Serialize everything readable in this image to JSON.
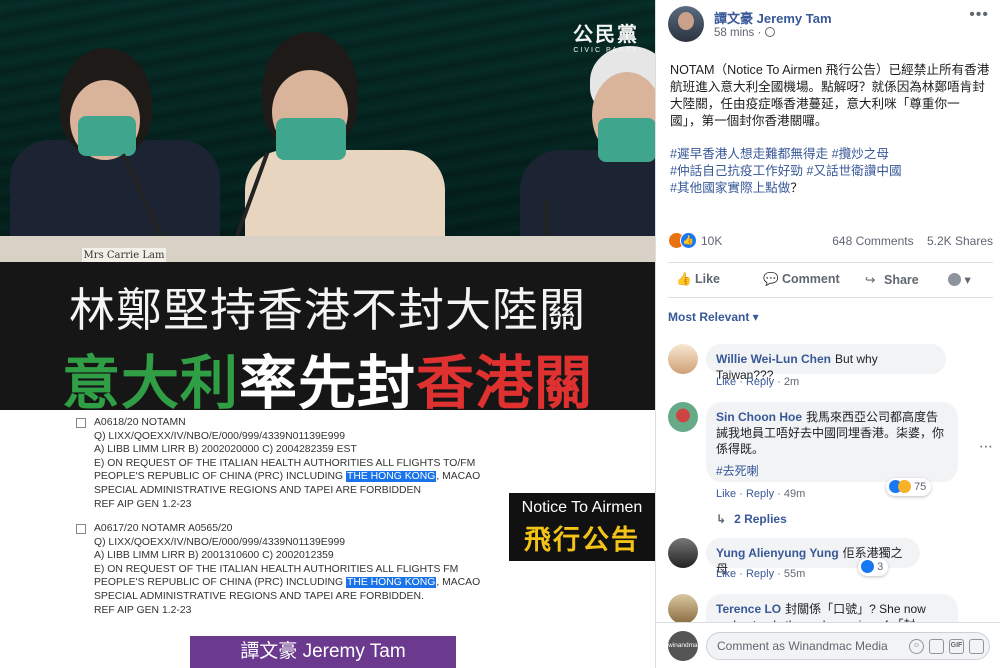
{
  "media": {
    "party_logo_zh": "公民黨",
    "party_logo_en": "CIVIC PARTY",
    "nameplate": "Mrs Carrie Lam",
    "headline_line1": "林鄭堅持香港不封大陸關",
    "headline_line2_parts": [
      {
        "text": "意大利",
        "color": "#2f9e44"
      },
      {
        "text": "率先封",
        "color": "#ffffff"
      },
      {
        "text": "香港關",
        "color": "#e03131"
      }
    ],
    "notams": [
      {
        "lines": [
          "A0618/20 NOTAMN",
          "Q) LIXX/QOEXX/IV/NBO/E/000/999/4339N01139E999",
          "A) LIBB LIMM LIRR B) 2002020000 C) 2004282359 EST",
          "E) ON REQUEST OF THE ITALIAN HEALTH AUTHORITIES ALL FLIGHTS TO/FM"
        ],
        "hl_before": "PEOPLE'S REPUBLIC OF CHINA (PRC) INCLUDING ",
        "hl_text": "THE HONG KONG",
        "hl_after": ", MACAO",
        "tail_lines": [
          "SPECIAL ADMINISTRATIVE REGIONS AND TAPEI ARE FORBIDDEN",
          "REF AIP GEN 1.2-23"
        ]
      },
      {
        "lines": [
          "A0617/20 NOTAMR A0565/20",
          "Q) LIXX/QOEXX/IV/NBO/E/000/999/4339N01139E999",
          "A) LIBB LIMM LIRR B) 2001310600 C) 2002012359",
          "E) ON REQUEST OF THE ITALIAN HEALTH AUTHORITIES ALL FLIGHTS FM"
        ],
        "hl_before": "PEOPLE'S REPUBLIC OF CHINA (PRC) INCLUDING ",
        "hl_text": "THE HONG KONG",
        "hl_after": ", MACAO",
        "tail_lines": [
          "SPECIAL ADMINISTRATIVE REGIONS AND TAPEI ARE FORBIDDEN.",
          "REF AIP GEN 1.2-23"
        ]
      }
    ],
    "tag_en": "Notice To Airmen",
    "tag_zh": "飛行公告",
    "credit": "譚文豪 Jeremy Tam"
  },
  "post": {
    "author": "譚文豪 Jeremy Tam",
    "time": "58 mins",
    "privacy_icon": "globe-icon",
    "more": "•••",
    "text": "NOTAM（Notice To Airmen 飛行公告）已經禁止所有香港航班進入意大利全國機場。點解呀？就係因為林鄭唔肯封大陸關，任由疫症喺香港蔓延，意大利咪「尊重你一國」，第一個封你香港關囉。",
    "tags": [
      "#遲早香港人想走難都無得走",
      "#攬炒之母",
      "#仲話自己抗疫工作好勁",
      "#又話世衛讚中國",
      "#其他國家實際上點做"
    ],
    "tags_suffix": "？",
    "reaction_count": "10K",
    "comments_count": "648 Comments",
    "shares_count": "5.2K Shares",
    "actions": {
      "like": "Like",
      "comment": "Comment",
      "share": "Share"
    },
    "sort_label": "Most Relevant ▾"
  },
  "comments": [
    {
      "author": "Willie Wei-Lun Chen",
      "text": "But why Taiwan???",
      "like": "Like",
      "reply": "Reply",
      "time": "2m"
    },
    {
      "author": "Sin Choon Hoe",
      "text": "我馬來西亞公司都高度告誡我地員工唔好去中國同埋香港。柒婆，你係得既。",
      "tag": "#去死喇",
      "like": "Like",
      "reply": "Reply",
      "time": "49m",
      "reactions": "75",
      "replies": "2 Replies"
    },
    {
      "author": "Yung Alienyung Yung",
      "text": "佢系港獨之母",
      "like": "Like",
      "reply": "Reply",
      "time": "55m",
      "reactions": "3"
    },
    {
      "author": "Terence LO",
      "text": "封關係「口號」? She now understands the real meaning of 「封"
    }
  ],
  "composer": {
    "avatar_label": "winandmac",
    "placeholder": "Comment as Winandmac Media",
    "icons": [
      "smiley-icon",
      "camera-icon",
      "gif-icon",
      "sticker-icon"
    ],
    "gif_label": "GIF"
  },
  "colors": {
    "fb_link": "#385898",
    "fb_blue": "#1877f2",
    "tag_yellow": "#f3c316",
    "credit_purple": "#6b3a8e"
  }
}
